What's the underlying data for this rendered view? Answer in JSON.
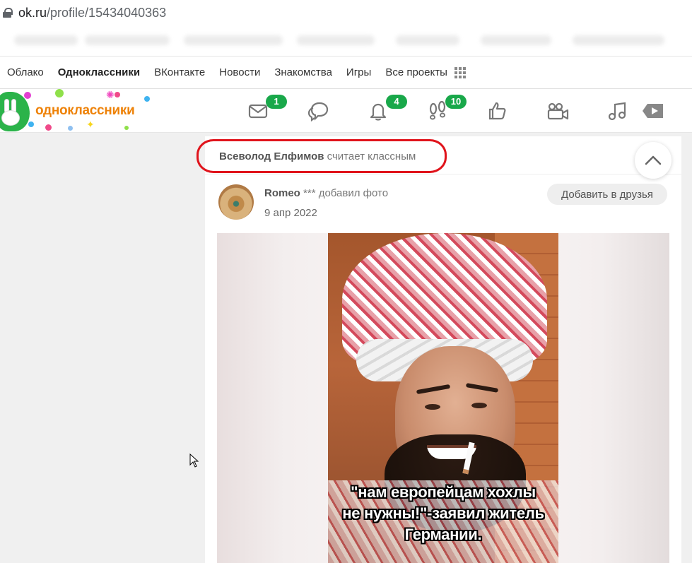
{
  "browser": {
    "url_host": "ok.ru",
    "url_path": "/profile/15434040363"
  },
  "portal_nav": {
    "items": [
      "Облако",
      "Одноклассники",
      "ВКонтакте",
      "Новости",
      "Знакомства",
      "Игры",
      "Все проекты"
    ],
    "active": "Одноклассники"
  },
  "header": {
    "logo_text": "одноклассники",
    "icons": [
      {
        "name": "messages-icon",
        "badge": "1"
      },
      {
        "name": "discussions-icon",
        "badge": ""
      },
      {
        "name": "notifications-icon",
        "badge": "4"
      },
      {
        "name": "guests-icon",
        "badge": "10"
      },
      {
        "name": "likes-icon",
        "badge": ""
      },
      {
        "name": "video-icon",
        "badge": ""
      },
      {
        "name": "music-icon",
        "badge": ""
      }
    ],
    "badge_color": "#19a84a",
    "brand_color": "#ee8208"
  },
  "feed": {
    "liker_name": "Всеволод Елфимов",
    "liker_action": "считает классным",
    "author_name": "Romeo",
    "author_suffix": "*** добавил фото",
    "date": "9 апр 2022",
    "add_friend_label": "Добавить в друзья",
    "photo_caption_lines": [
      "\"нам европейцам хохлы",
      "не нужны!\"-заявил житель",
      "Германии."
    ]
  }
}
